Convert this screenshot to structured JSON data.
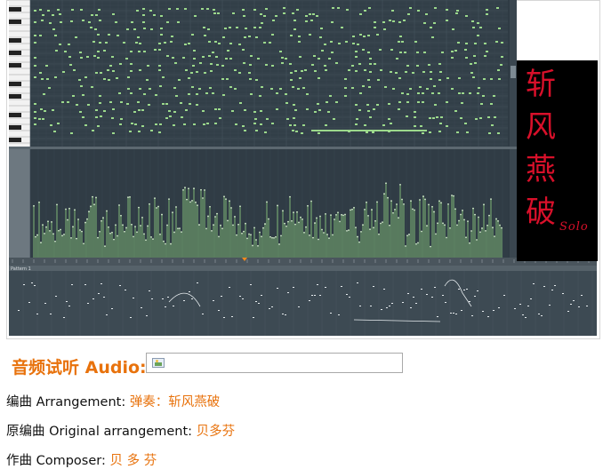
{
  "screenshot": {
    "title_chars": [
      "斩",
      "风",
      "燕",
      "破"
    ],
    "title_suffix": "Solo",
    "pattern_label": "Pattern 1",
    "colors": {
      "note": "#9cd98c",
      "velocity": "#8fcf7f",
      "background": "#34414a",
      "title_text": "#d8102a"
    }
  },
  "audio": {
    "label": "音频试听 Audio:",
    "player_icon": "broken-plugin-icon"
  },
  "credits": {
    "arrangement_label": "编曲 Arrangement: ",
    "arrangement_value": "弹奏：斩风燕破",
    "original_label": "原编曲 Original arrangement: ",
    "original_value": "贝多芬",
    "composer_label": "作曲 Composer: ",
    "composer_value": "贝 多 芬"
  },
  "colors": {
    "accent": "#e8720c"
  }
}
